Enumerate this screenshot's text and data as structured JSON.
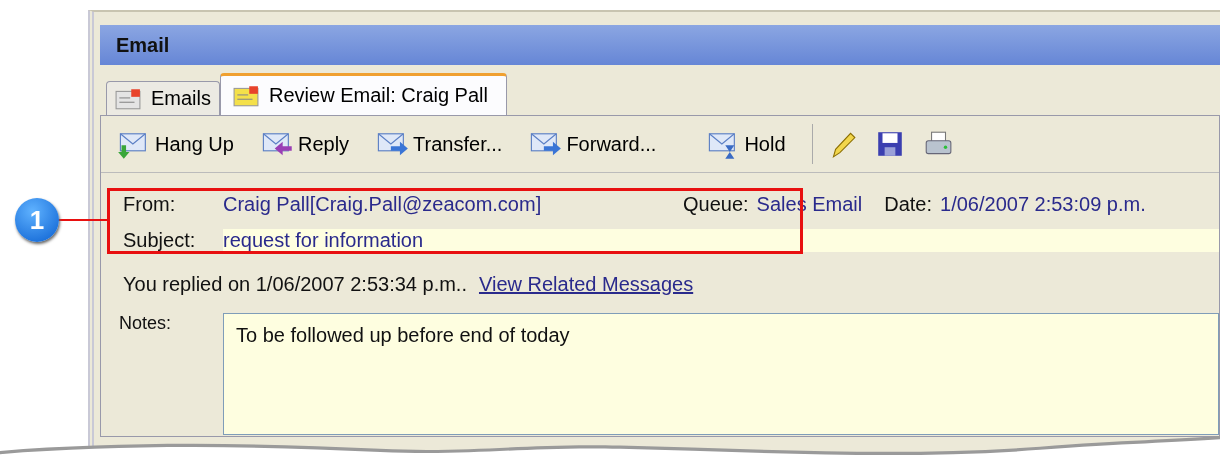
{
  "window": {
    "title": "Email"
  },
  "tabs": [
    {
      "label": "Emails",
      "selected": false
    },
    {
      "label": "Review Email: Craig Pall",
      "selected": true
    }
  ],
  "toolbar": {
    "buttons": [
      "Hang Up",
      "Reply",
      "Transfer...",
      "Forward...",
      "Hold"
    ]
  },
  "header": {
    "from_label": "From:",
    "from": "Craig Pall[Craig.Pall@zeacom.com]",
    "queue_label": "Queue:",
    "queue": "Sales Email",
    "date_label": "Date:",
    "date": "1/06/2007 2:53:09 p.m.",
    "subject_label": "Subject:",
    "subject": "request for information"
  },
  "replied": {
    "text": "You replied on 1/06/2007 2:53:34 p.m..",
    "link": "View Related Messages"
  },
  "notes": {
    "label": "Notes:",
    "value": "To be followed up before end of today"
  },
  "callout": {
    "number": "1"
  }
}
